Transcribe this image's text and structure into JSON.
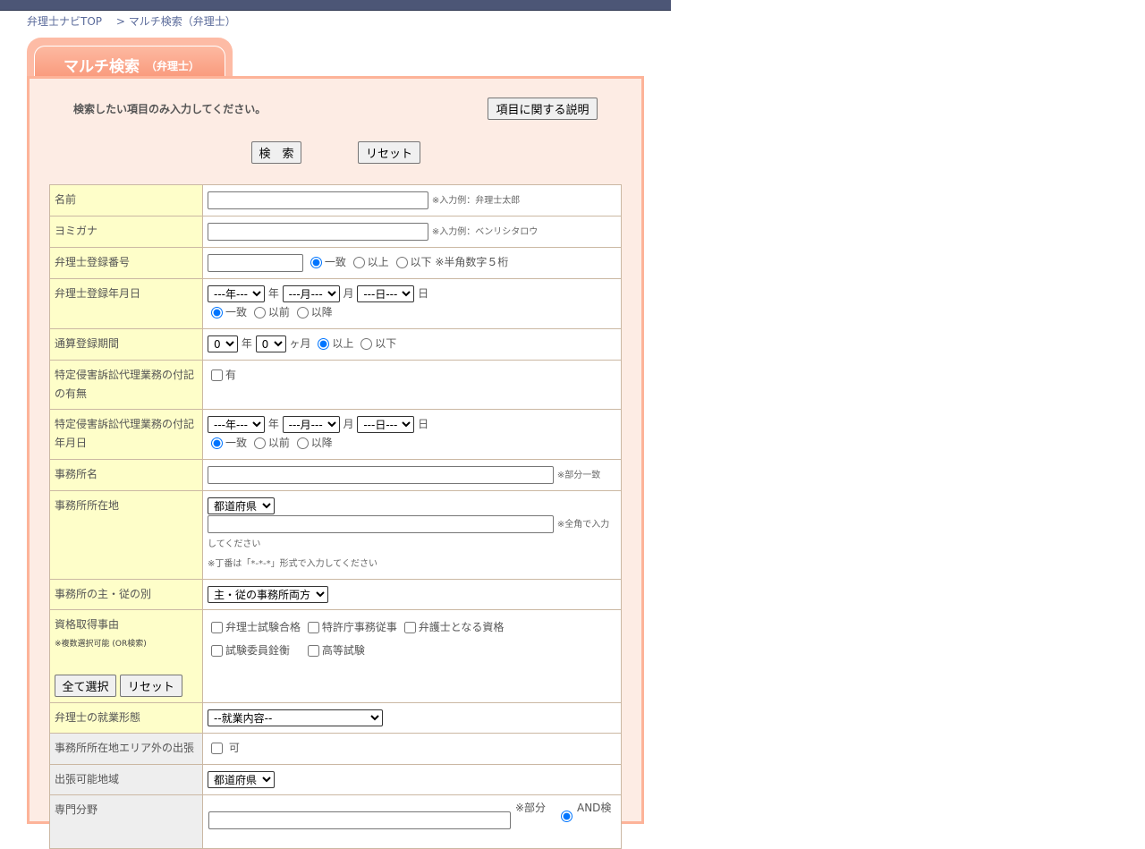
{
  "breadcrumb": {
    "top": "弁理士ナビTOP",
    "sep": ">",
    "current": "マルチ検索（弁理士）"
  },
  "tab": {
    "title": "マルチ検索",
    "subtitle": "（弁理士）"
  },
  "intro": "検索したい項目のみ入力してください。",
  "buttons": {
    "explain": "項目に関する説明",
    "search": "検　索",
    "reset": "リセット",
    "select_all": "全て選択",
    "reset2": "リセット"
  },
  "rows": {
    "name": {
      "label": "名前",
      "note": "※入力例：弁理士太郎"
    },
    "kana": {
      "label": "ヨミガナ",
      "note": "※入力例：ベンリシタロウ"
    },
    "regnum": {
      "label": "弁理士登録番号",
      "opt1": "一致",
      "opt2": "以上",
      "opt3": "以下",
      "note": "※半角数字５桁"
    },
    "regdate": {
      "label": "弁理士登録年月日",
      "year": "---年---",
      "month": "---月---",
      "day": "---日---",
      "u_year": "年",
      "u_month": "月",
      "u_day": "日",
      "opt1": "一致",
      "opt2": "以前",
      "opt3": "以降"
    },
    "period": {
      "label": "通算登録期間",
      "year_val": "0",
      "month_val": "0",
      "u_year": "年",
      "u_month": "ヶ月",
      "opt1": "以上",
      "opt2": "以下"
    },
    "tokutei": {
      "label": "特定侵害訴訟代理業務の付記の有無",
      "chk": "有"
    },
    "tokutei_date": {
      "label": "特定侵害訴訟代理業務の付記年月日",
      "year": "---年---",
      "month": "---月---",
      "day": "---日---",
      "u_year": "年",
      "u_month": "月",
      "u_day": "日",
      "opt1": "一致",
      "opt2": "以前",
      "opt3": "以降"
    },
    "office": {
      "label": "事務所名",
      "note": "※部分一致"
    },
    "office_addr": {
      "label": "事務所所在地",
      "pref": "都道府県",
      "note1": "※全角で入力してください",
      "note2": "※丁番は「*-*-*」形式で入力してください"
    },
    "office_type": {
      "label": "事務所の主・従の別",
      "value": "主・従の事務所両方"
    },
    "qual": {
      "label": "資格取得事由",
      "sub": "※複数選択可能 (OR検索)",
      "c1": "弁理士試験合格",
      "c2": "特許庁事務従事",
      "c3": "弁護士となる資格",
      "c4": "試験委員銓衡",
      "c5": "高等試験"
    },
    "work": {
      "label": "弁理士の就業形態",
      "value": "--就業内容--"
    },
    "trip": {
      "label": "事務所所在地エリア外の出張",
      "chk": "可"
    },
    "trip_area": {
      "label": "出張可能地域",
      "pref": "都道府県"
    },
    "field": {
      "label": "専門分野",
      "note": "※部分",
      "opt": "AND検"
    }
  },
  "colors": {
    "topbar": "#4c5676",
    "panel_bg": "#fdece4",
    "panel_border": "#fdb399",
    "label_bg": "#fefec9",
    "label_gray": "#eeeeee"
  }
}
